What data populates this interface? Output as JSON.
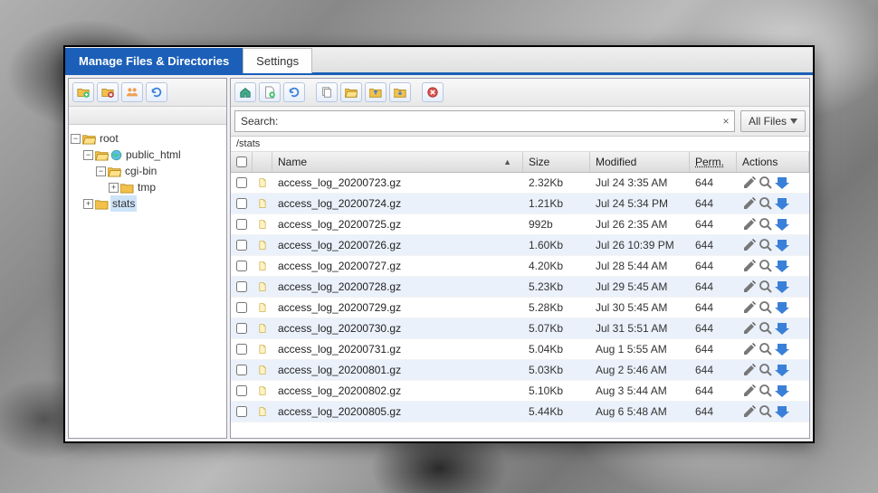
{
  "tabs": {
    "manage": "Manage Files & Directories",
    "settings": "Settings"
  },
  "leftToolbar": [
    "new-folder",
    "delete-folder",
    "users",
    "refresh"
  ],
  "rightToolbar": [
    "home",
    "new-file",
    "refresh-green",
    "",
    "copy",
    "open-folder",
    "folder-out",
    "folder-in",
    "",
    "delete"
  ],
  "search": {
    "label": "Search:",
    "value": "",
    "filter": "All Files"
  },
  "path": "/stats",
  "tree": {
    "root": "root",
    "public_html": "public_html",
    "cgi_bin": "cgi-bin",
    "tmp": "tmp",
    "stats": "stats"
  },
  "columns": {
    "name": "Name",
    "size": "Size",
    "modified": "Modified",
    "perm": "Perm.",
    "actions": "Actions"
  },
  "files": [
    {
      "name": "access_log_20200723.gz",
      "size": "2.32Kb",
      "modified": "Jul 24 3:35 AM",
      "perm": "644"
    },
    {
      "name": "access_log_20200724.gz",
      "size": "1.21Kb",
      "modified": "Jul 24 5:34 PM",
      "perm": "644"
    },
    {
      "name": "access_log_20200725.gz",
      "size": "992b",
      "modified": "Jul 26 2:35 AM",
      "perm": "644"
    },
    {
      "name": "access_log_20200726.gz",
      "size": "1.60Kb",
      "modified": "Jul 26 10:39 PM",
      "perm": "644"
    },
    {
      "name": "access_log_20200727.gz",
      "size": "4.20Kb",
      "modified": "Jul 28 5:44 AM",
      "perm": "644"
    },
    {
      "name": "access_log_20200728.gz",
      "size": "5.23Kb",
      "modified": "Jul 29 5:45 AM",
      "perm": "644"
    },
    {
      "name": "access_log_20200729.gz",
      "size": "5.28Kb",
      "modified": "Jul 30 5:45 AM",
      "perm": "644"
    },
    {
      "name": "access_log_20200730.gz",
      "size": "5.07Kb",
      "modified": "Jul 31 5:51 AM",
      "perm": "644"
    },
    {
      "name": "access_log_20200731.gz",
      "size": "5.04Kb",
      "modified": "Aug 1 5:55 AM",
      "perm": "644"
    },
    {
      "name": "access_log_20200801.gz",
      "size": "5.03Kb",
      "modified": "Aug 2 5:46 AM",
      "perm": "644"
    },
    {
      "name": "access_log_20200802.gz",
      "size": "5.10Kb",
      "modified": "Aug 3 5:44 AM",
      "perm": "644"
    },
    {
      "name": "access_log_20200805.gz",
      "size": "5.44Kb",
      "modified": "Aug 6 5:48 AM",
      "perm": "644"
    }
  ]
}
